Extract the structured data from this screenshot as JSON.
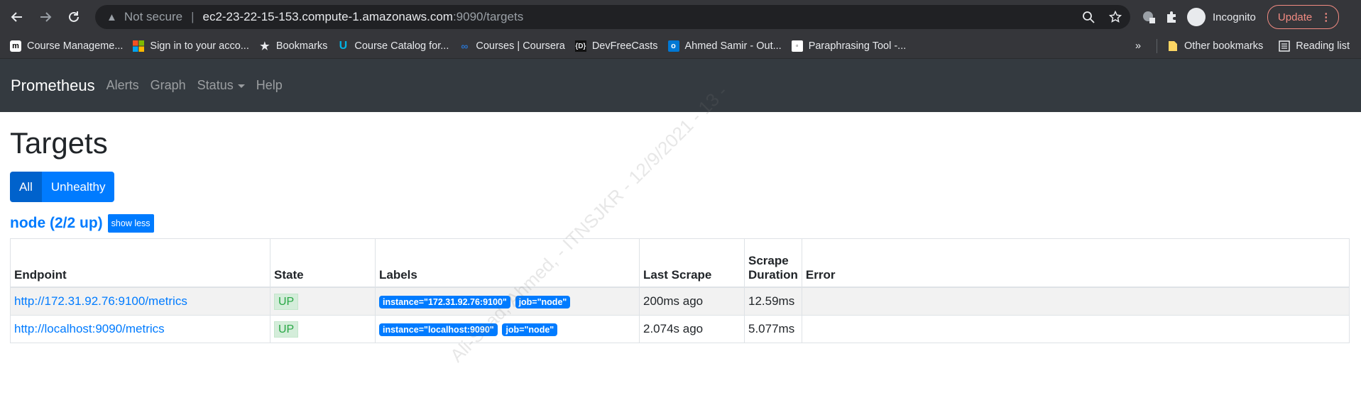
{
  "browser": {
    "address_warning": "Not secure",
    "url_host": "ec2-23-22-15-153.compute-1.amazonaws.com",
    "url_path": ":9090/targets",
    "profile_label": "Incognito",
    "update_label": "Update",
    "bookmarks": [
      {
        "label": "Course Manageme...",
        "icon": "m-icon"
      },
      {
        "label": "Sign in to your acco...",
        "icon": "microsoft-icon"
      },
      {
        "label": "Bookmarks",
        "icon": "star-icon"
      },
      {
        "label": "Course Catalog for...",
        "icon": "udacity-icon"
      },
      {
        "label": "Courses | Coursera",
        "icon": "coursera-icon"
      },
      {
        "label": "DevFreeCasts",
        "icon": "devfreecasts-icon"
      },
      {
        "label": "Ahmed Samir - Out...",
        "icon": "outlook-icon"
      },
      {
        "label": "Paraphrasing Tool -...",
        "icon": "paraphrasing-icon"
      }
    ],
    "other_bookmarks": "Other bookmarks",
    "reading_list": "Reading list"
  },
  "navbar": {
    "brand": "Prometheus",
    "links": [
      "Alerts",
      "Graph",
      "Status",
      "Help"
    ]
  },
  "page": {
    "title": "Targets",
    "filter_all": "All",
    "filter_unhealthy": "Unhealthy",
    "pool_name": "node (2/2 up)",
    "show_less": "show less"
  },
  "table": {
    "headers": [
      "Endpoint",
      "State",
      "Labels",
      "Last Scrape",
      "Scrape Duration",
      "Error"
    ],
    "rows": [
      {
        "endpoint": "http://172.31.92.76:9100/metrics",
        "state": "UP",
        "labels": [
          "instance=\"172.31.92.76:9100\"",
          "job=\"node\""
        ],
        "last_scrape": "200ms ago",
        "duration": "12.59ms",
        "error": ""
      },
      {
        "endpoint": "http://localhost:9090/metrics",
        "state": "UP",
        "labels": [
          "instance=\"localhost:9090\"",
          "job=\"node\""
        ],
        "last_scrape": "2.074s ago",
        "duration": "5.077ms",
        "error": ""
      }
    ]
  },
  "watermark_text": "Ali-Saad, Ahmed, - ITNSJKR - 12/9/2021 - 13 -"
}
